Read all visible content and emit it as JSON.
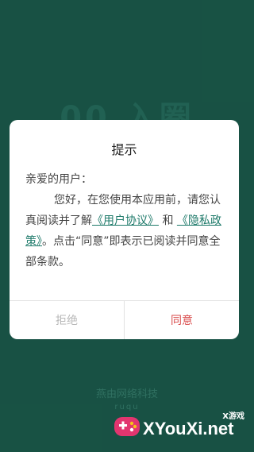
{
  "background": {
    "logo_text": "00 入圈",
    "company_name": "燕由网络科技",
    "company_subtitle": "ruqu"
  },
  "dialog": {
    "title": "提示",
    "greeting": "亲爱的用户：",
    "body_part1": "您好，在您使用本应用前，请您认真阅读并了解",
    "link_user_agreement": "《用户协议》",
    "connector": "和",
    "link_privacy_policy": "《隐私政策》",
    "body_part2": "。点击“同意”即表示已阅读并同意全部条款。",
    "reject_label": "拒绝",
    "accept_label": "同意"
  },
  "watermark": {
    "small_label": "X游戏",
    "site_text": "XYouXi.net"
  },
  "colors": {
    "app_background": "#1e6655",
    "link": "#1e7a6a",
    "accept": "#d94b4b",
    "reject": "#b8b8b8"
  }
}
